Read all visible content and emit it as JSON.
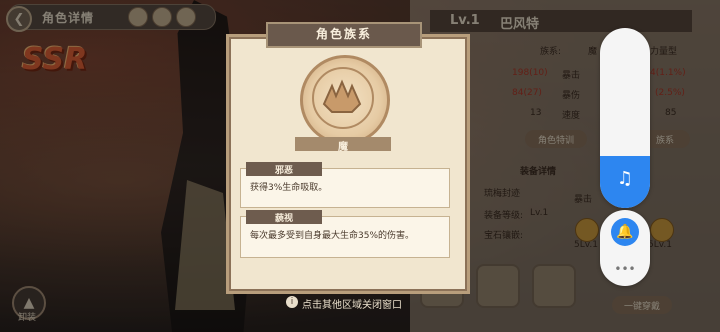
{
  "header": {
    "title": "角色详情",
    "back_icon": "back-arrow-icon"
  },
  "rarity": "SSR",
  "unequip_label": "卸装",
  "right_panel": {
    "level": "Lv.1",
    "name": "巴风特",
    "race_label": "族系:",
    "race_value": "魔",
    "type_value": "力量型",
    "stats": [
      {
        "value": "198(10)",
        "label": "暴击"
      },
      {
        "value": "84(27)",
        "label": "暴伤"
      },
      {
        "value": "13",
        "label": "速度"
      }
    ],
    "stats_right": [
      "4(1.1%)",
      "(2.5%)",
      "85"
    ],
    "buttons": [
      "角色特训",
      "族系"
    ],
    "equip_section": "装备详情",
    "set_name": "琉梅封迹",
    "crit_label": "暴击",
    "equip_level_label": "装备等级:",
    "equip_level_value": "Lv.1",
    "gem_label": "宝石镶嵌:",
    "gem_levels": [
      "5Lv.1",
      "5Lv.1"
    ],
    "one_click": "一键穿戴"
  },
  "dialog": {
    "title": "角色族系",
    "race_name": "魔",
    "skills": [
      {
        "name": "邪恶",
        "desc": "获得3%生命吸取。"
      },
      {
        "name": "藐视",
        "desc": "每次最多受到自身最大生命35%的伤害。"
      }
    ]
  },
  "hint": "点击其他区域关闭窗口",
  "volume_overlay": {
    "music_icon": "music-note-icon",
    "bell_icon": "bell-muted-icon",
    "more_icon": "more-dots-icon",
    "volume_level": 0.29
  }
}
